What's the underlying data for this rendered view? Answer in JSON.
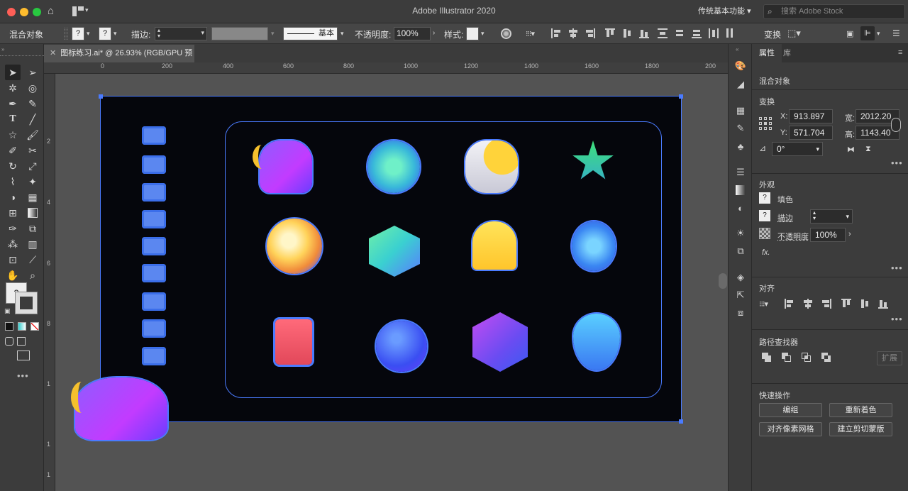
{
  "window": {
    "title": "Adobe Illustrator 2020",
    "workspace": "传统基本功能",
    "search_placeholder": "搜索 Adobe Stock"
  },
  "controlbar": {
    "selection_label": "混合对象",
    "stroke_label": "描边:",
    "brush_label": "基本",
    "opacity_label": "不透明度:",
    "opacity_value": "100%",
    "style_label": "样式:",
    "transform_label": "变换"
  },
  "document": {
    "tab_title": "图标练习.ai* @ 26.93% (RGB/GPU 预览)"
  },
  "ruler": {
    "h_ticks": [
      "0",
      "200",
      "400",
      "600",
      "800",
      "1000",
      "1200",
      "1400",
      "1600",
      "1800",
      "200"
    ],
    "v_ticks": [
      "2",
      "4",
      "6",
      "8",
      "1",
      "1",
      "1"
    ]
  },
  "panel": {
    "tabs": [
      "属性",
      "库"
    ],
    "object_type": "混合对象",
    "transform": {
      "title": "变换",
      "x_label": "X:",
      "x_value": "913.897",
      "y_label": "Y:",
      "y_value": "571.704",
      "w_label": "宽:",
      "w_value": "2012.20",
      "h_label": "高:",
      "h_value": "1143.40",
      "angle_value": "0°"
    },
    "appearance": {
      "title": "外观",
      "fill_label": "填色",
      "stroke_label": "描边",
      "opacity_label": "不透明度",
      "opacity_value": "100%",
      "fx_label": "fx."
    },
    "align_title": "对齐",
    "pathfinder_title": "路径查找器",
    "expand_label": "扩展",
    "quick_actions": {
      "title": "快速操作",
      "group": "编组",
      "recolor": "重新着色",
      "align_pixel": "对齐像素网格",
      "clip_mask": "建立剪切蒙版"
    }
  },
  "colors": {
    "selection": "#4a7bff",
    "artboard_bg": "#05060c",
    "ui_dark": "#3c3c3c",
    "canvas": "#535353"
  },
  "icons": [
    "cloud-moon",
    "radar",
    "sun-cloud",
    "star",
    "earth",
    "cube",
    "bell",
    "bluetooth",
    "gift",
    "planet",
    "hexagon",
    "location-pin"
  ]
}
